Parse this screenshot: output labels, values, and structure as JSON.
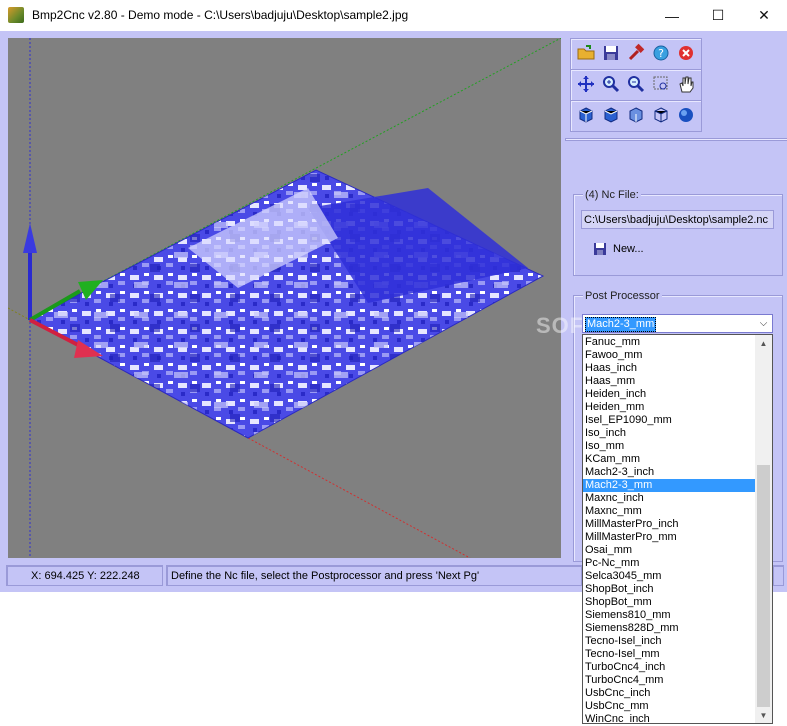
{
  "window": {
    "title": "Bmp2Cnc v2.80 - Demo mode - C:\\Users\\badjuju\\Desktop\\sample2.jpg",
    "minimize_glyph": "—",
    "maximize_glyph": "☐",
    "close_glyph": "✕"
  },
  "toolbar_rows": [
    [
      "open-folder-icon",
      "save-disk-icon",
      "hammer-icon",
      "help-icon",
      "close-red-icon"
    ],
    [
      "move-arrows-icon",
      "zoom-in-icon",
      "zoom-out-icon",
      "zoom-window-icon",
      "hand-pan-icon"
    ],
    [
      "cube-view-1-icon",
      "cube-view-2-icon",
      "cube-view-3-icon",
      "cube-wireframe-icon",
      "sphere-icon"
    ]
  ],
  "nc_file": {
    "label": "(4) Nc File:",
    "path": "C:\\Users\\badjuju\\Desktop\\sample2.nc",
    "new_button_label": "New..."
  },
  "post_processor": {
    "label": "Post Processor",
    "selected": "Mach2-3_mm",
    "options": [
      "Fanuc_mm",
      "Fawoo_mm",
      "Haas_inch",
      "Haas_mm",
      "Heiden_inch",
      "Heiden_mm",
      "Isel_EP1090_mm",
      "Iso_inch",
      "Iso_mm",
      "KCam_mm",
      "Mach2-3_inch",
      "Mach2-3_mm",
      "Maxnc_inch",
      "Maxnc_mm",
      "MillMasterPro_inch",
      "MillMasterPro_mm",
      "Osai_mm",
      "Pc-Nc_mm",
      "Selca3045_mm",
      "ShopBot_inch",
      "ShopBot_mm",
      "Siemens810_mm",
      "Siemens828D_mm",
      "Tecno-Isel_inch",
      "Tecno-Isel_mm",
      "TurboCnc4_inch",
      "TurboCnc4_mm",
      "UsbCnc_inch",
      "UsbCnc_mm",
      "WinCnc_inch"
    ]
  },
  "status": {
    "coords": "X: 694.425 Y: 222.248",
    "message": "Define the Nc file, select the Postprocessor and press 'Next Pg'"
  },
  "watermark": "SOFTPEDIA",
  "colors": {
    "window_bg": "#c4c4f6",
    "viewport_bg": "#808080",
    "selection": "#3399ff",
    "heightmap_blue": "#3a3ae0"
  }
}
